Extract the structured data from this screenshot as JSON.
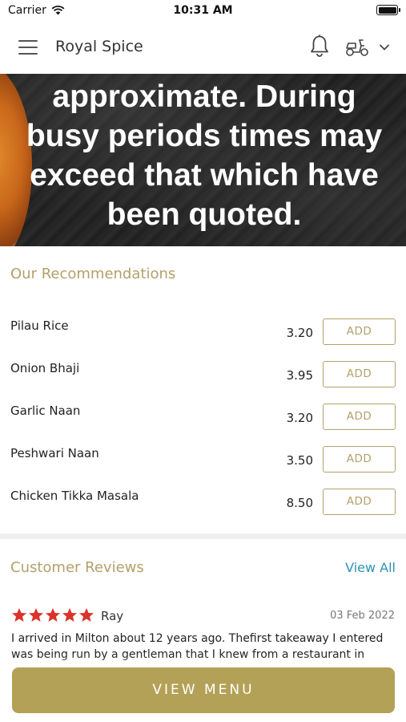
{
  "status_bar": {
    "carrier": "Carrier",
    "time": "10:31 AM"
  },
  "header": {
    "title": "Royal Spice",
    "icons": [
      "menu-icon",
      "bell-icon",
      "scooter-icon",
      "chevron-down-icon"
    ]
  },
  "banner": {
    "text": "approximate. During busy periods times may exceed that which have been quoted."
  },
  "recommendations": {
    "title": "Our Recommendations",
    "add_label": "ADD",
    "items": [
      {
        "name": "Pilau Rice",
        "price": "3.20"
      },
      {
        "name": "Onion Bhaji",
        "price": "3.95"
      },
      {
        "name": "Garlic Naan",
        "price": "3.20"
      },
      {
        "name": "Peshwari Naan",
        "price": "3.50"
      },
      {
        "name": "Chicken Tikka Masala",
        "price": "8.50"
      }
    ]
  },
  "reviews": {
    "title": "Customer Reviews",
    "view_all": "View All",
    "items": [
      {
        "rating": 5,
        "author": "Ray",
        "date": "03 Feb 2022",
        "text": "I arrived in Milton about 12 years ago. Thefirst takeaway I entered was being run by a gentleman that I knew from a restaurant in"
      }
    ]
  },
  "footer": {
    "view_menu": "VIEW MENU"
  },
  "colors": {
    "accent": "#b3a06a",
    "button": "#b3a157",
    "link": "#2c93b5",
    "star": "#d9342b"
  }
}
